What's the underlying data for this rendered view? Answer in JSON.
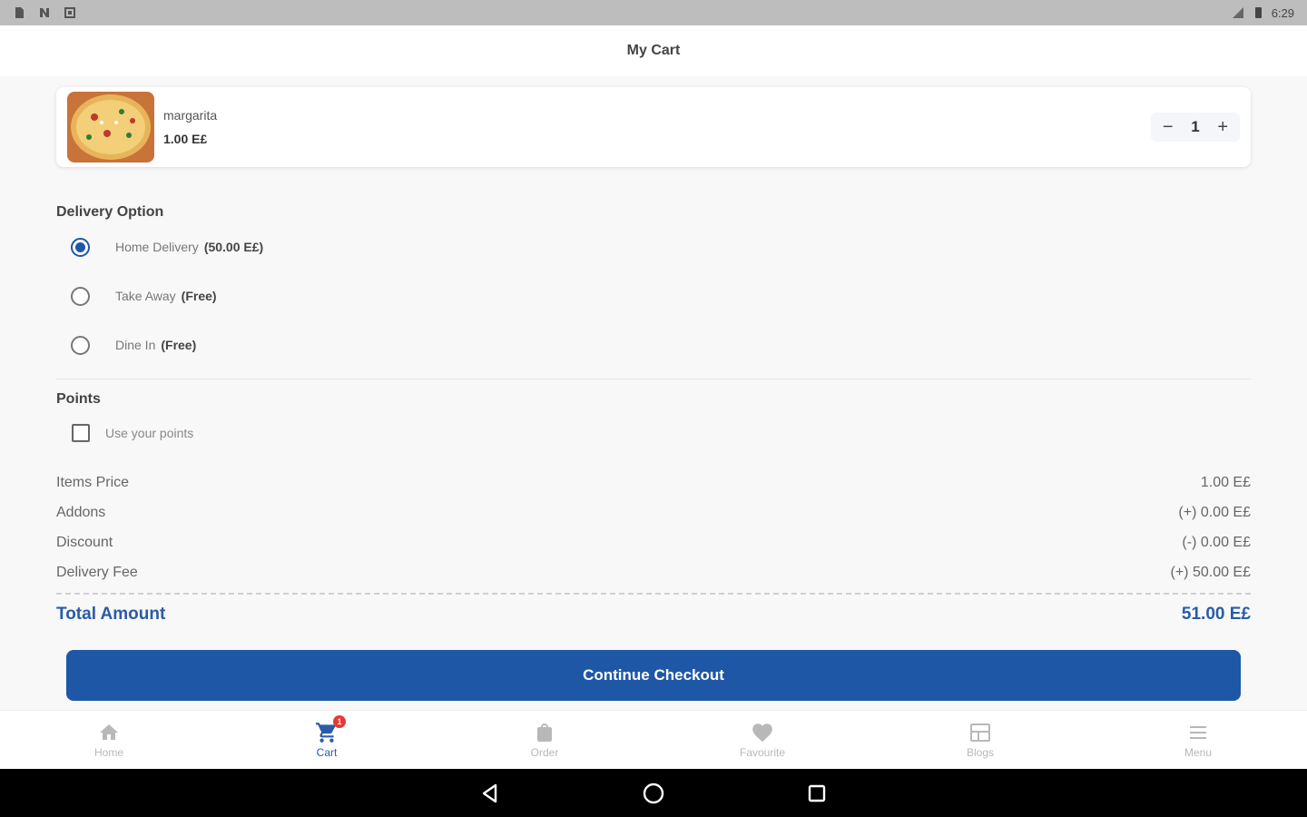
{
  "status_bar": {
    "time": "6:29"
  },
  "header": {
    "title": "My Cart"
  },
  "cart": {
    "items": [
      {
        "name": "margarita",
        "price": "1.00 E£",
        "quantity": "1"
      }
    ]
  },
  "delivery": {
    "title": "Delivery Option",
    "options": [
      {
        "label": "Home Delivery",
        "extra": "(50.00 E£)",
        "selected": true
      },
      {
        "label": "Take Away",
        "extra": "(Free)",
        "selected": false
      },
      {
        "label": "Dine In",
        "extra": "(Free)",
        "selected": false
      }
    ]
  },
  "points": {
    "title": "Points",
    "checkbox_label": "Use your points",
    "checked": false
  },
  "summary": {
    "rows": [
      {
        "label": "Items Price",
        "value": "1.00 E£"
      },
      {
        "label": "Addons",
        "value": "(+) 0.00 E£"
      },
      {
        "label": "Discount",
        "value": "(-) 0.00 E£"
      },
      {
        "label": "Delivery Fee",
        "value": "(+) 50.00 E£"
      }
    ],
    "total_label": "Total Amount",
    "total_value": "51.00 E£"
  },
  "checkout": {
    "label": "Continue Checkout"
  },
  "bottom_nav": {
    "items": [
      {
        "label": "Home",
        "icon": "home-icon"
      },
      {
        "label": "Cart",
        "icon": "cart-icon",
        "badge": "1",
        "active": true
      },
      {
        "label": "Order",
        "icon": "bag-icon"
      },
      {
        "label": "Favourite",
        "icon": "heart-icon"
      },
      {
        "label": "Blogs",
        "icon": "blog-icon"
      },
      {
        "label": "Menu",
        "icon": "menu-icon"
      }
    ]
  },
  "colors": {
    "primary": "#1f57a7",
    "accent_text": "#2a5ba8",
    "badge": "#e53935"
  }
}
